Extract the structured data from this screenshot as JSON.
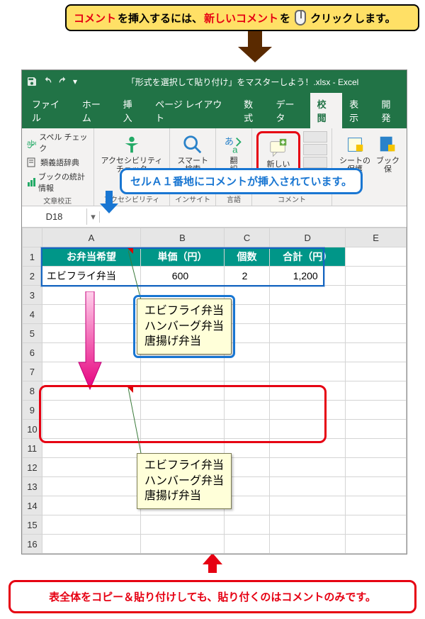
{
  "callout_top": {
    "part1": "コメント",
    "part2": "を挿入するには、",
    "part3": "新しいコメント",
    "part4": "を",
    "part5": "クリック",
    "part6": "します。"
  },
  "window_title": "「形式を選択して貼り付け」をマスターしよう！.xlsx - Excel",
  "tabs": {
    "file": "ファイル",
    "home": "ホーム",
    "insert": "挿入",
    "layout": "ページ レイアウト",
    "formulas": "数式",
    "data": "データ",
    "review": "校閲",
    "view": "表示",
    "dev": "開発"
  },
  "ribbon": {
    "proofing": {
      "spell": "スペル チェック",
      "thesaurus": "類義語辞典",
      "stats": "ブックの統計情報",
      "group": "文章校正"
    },
    "access": {
      "label": "アクセシビリティ\nチェック",
      "group": "アクセシビリティ"
    },
    "smart": {
      "label": "スマート\n検索",
      "group": "インサイト"
    },
    "translate": {
      "label": "翻\n訳",
      "group": "言語"
    },
    "newcomment": {
      "label": "新しい\nコメント",
      "group": "コメント"
    },
    "protect": {
      "sheet": "シートの\n保護",
      "book": "ブック\n保"
    }
  },
  "name_box": "D18",
  "callout_blue": "セルＡ１番地にコメントが挿入されています。",
  "columns": {
    "A": "A",
    "B": "B",
    "C": "C",
    "D": "D",
    "E": "E"
  },
  "rows": [
    "1",
    "2",
    "3",
    "4",
    "5",
    "6",
    "7",
    "8",
    "9",
    "10",
    "11",
    "12",
    "13",
    "14",
    "15",
    "16"
  ],
  "header_row": {
    "A": "お弁当希望",
    "B": "単価（円）",
    "C": "個数",
    "D": "合計（円）"
  },
  "data_row": {
    "A": "エビフライ弁当",
    "B": "600",
    "C": "2",
    "D": "1,200"
  },
  "comment_text": {
    "l1": "エビフライ弁当",
    "l2": "ハンバーグ弁当",
    "l3": "唐揚げ弁当"
  },
  "callout_bottom": "表全体をコピー＆貼り付けしても、貼り付くのはコメントのみです。"
}
